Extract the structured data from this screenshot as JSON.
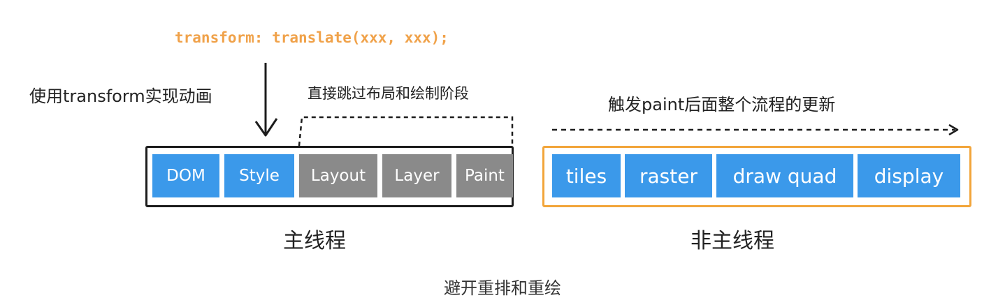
{
  "code": "transform: translate(xxx, xxx);",
  "notes": {
    "use_transform": "使用transform实现动画",
    "skip_layout_paint": "直接跳过布局和绘制阶段",
    "trigger_after_paint": "触发paint后面整个流程的更新"
  },
  "main_thread": {
    "label": "主线程",
    "stages": [
      "DOM",
      "Style",
      "Layout",
      "Layer",
      "Paint"
    ]
  },
  "non_main_thread": {
    "label": "非主线程",
    "stages": [
      "tiles",
      "raster",
      "draw quad",
      "display"
    ]
  },
  "caption": "避开重排和重绘",
  "colors": {
    "active_stage": "#3b99ea",
    "skipped_stage": "#8a8a8a",
    "code_text": "#f0a24a",
    "compositor_border": "#f2a53a",
    "main_border": "#1c1c1c"
  }
}
